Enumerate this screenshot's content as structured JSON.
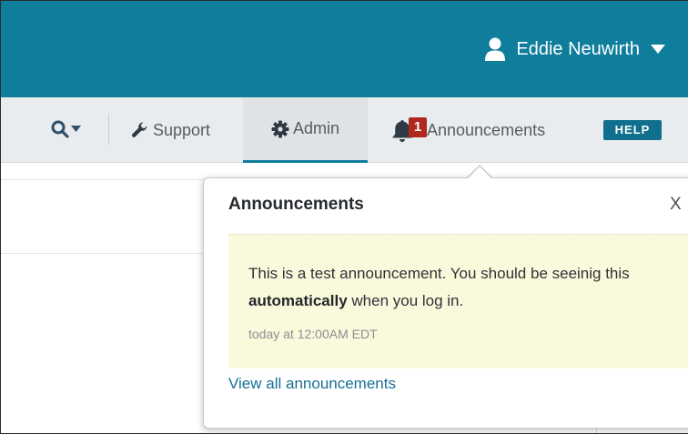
{
  "header": {
    "user_name": "Eddie Neuwirth",
    "user_icon": "person-icon",
    "menu_icon": "caret-down-icon",
    "background_color": "#0f7d9c"
  },
  "nav": {
    "search_icon": "search-icon",
    "support_label": "Support",
    "support_icon": "wrench-icon",
    "admin_label": "Admin",
    "admin_icon": "gear-icon",
    "announcements_label": "Announcements",
    "announcements_icon": "bell-icon",
    "announcements_badge": "1",
    "help_label": "HELP",
    "active_tab": "Admin",
    "active_color": "#0f7d9c",
    "badge_color": "#b0281d"
  },
  "popover": {
    "title": "Announcements",
    "close_label": "X",
    "announcement": {
      "text_before": "This is a test announcement.  You should be seeinig this ",
      "text_bold": "automatically",
      "text_after": " when you log in.",
      "timestamp": "today at 12:00AM EDT",
      "background_color": "#fbf9dc"
    },
    "view_all_label": "View all announcements",
    "link_color": "#176f94"
  }
}
